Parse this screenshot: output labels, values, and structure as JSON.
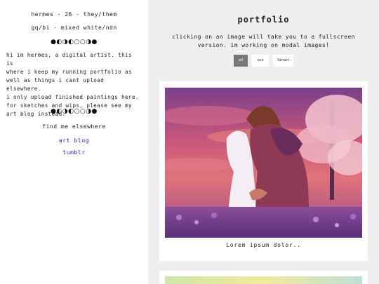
{
  "sidebar": {
    "name_line": "hermes - 26 - they/them",
    "identity_line": "gq/bi - mixed white/ndn",
    "moon_divider_1": "●◐◑◐○○◑●",
    "bio_lines": [
      "hi im hermes, a digital artist. this is",
      "where i keep my running portfolio as",
      "well as things i cant upload elsewhere.",
      "i only upload finished paintings here.",
      "for sketches and wips, please see my",
      "art blog instead."
    ],
    "moon_divider_2": "●◐◑◐○○◑●",
    "find_me_heading": "find me elsewhere",
    "links": [
      "art blog",
      "tumblr"
    ],
    "link_color": "#2b24c9"
  },
  "main": {
    "title": "portfolio",
    "subtitle": "clicking on an image will take you to a fullscreen version. im working on modal images!",
    "filters": [
      {
        "label": "all",
        "active": true
      },
      {
        "label": "ocs",
        "active": false
      },
      {
        "label": "fanart",
        "active": false
      }
    ],
    "cards": [
      {
        "caption": "Lorem ipsum dolor..",
        "image": "painting-two-figures-kissing-sunset-icon"
      },
      {
        "caption": "",
        "image": "painting-pastel-sky-icon"
      }
    ]
  },
  "colors": {
    "sidebar_bg": "#ffffff",
    "main_bg": "#efefef",
    "active_filter_bg": "#777777"
  }
}
